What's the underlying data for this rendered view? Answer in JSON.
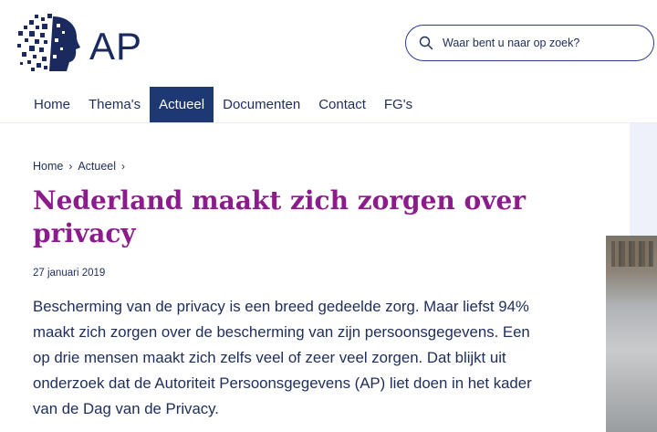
{
  "brand": {
    "logo_text": "AP"
  },
  "search": {
    "placeholder": "Waar bent u naar op zoek?"
  },
  "nav": {
    "items": [
      {
        "label": "Home"
      },
      {
        "label": "Thema's"
      },
      {
        "label": "Actueel",
        "active": true
      },
      {
        "label": "Documenten"
      },
      {
        "label": "Contact"
      },
      {
        "label": "FG's"
      }
    ]
  },
  "breadcrumb": {
    "items": [
      "Home",
      "Actueel"
    ],
    "separator": "›"
  },
  "article": {
    "title": "Nederland maakt zich zorgen over privacy",
    "date": "27 januari 2019",
    "lead": "Bescherming van de privacy is een breed gedeelde zorg. Maar liefst 94% maakt zich zorgen over de bescherming van zijn persoonsgegevens. Een op drie mensen maakt zich zelfs veel of zeer veel zorgen. Dat blijkt uit onderzoek dat de Autoriteit Persoonsgegevens (AP) liet doen in het kader van de Dag van de Privacy."
  },
  "colors": {
    "navy": "#1e2d5a",
    "nav_active_bg": "#1e3873",
    "title_purple": "#8c1c8c",
    "side_panel": "#eef1fa"
  },
  "icons": {
    "search": "search-icon",
    "logo": "ap-logo-icon",
    "chevron": "chevron-right-icon"
  }
}
